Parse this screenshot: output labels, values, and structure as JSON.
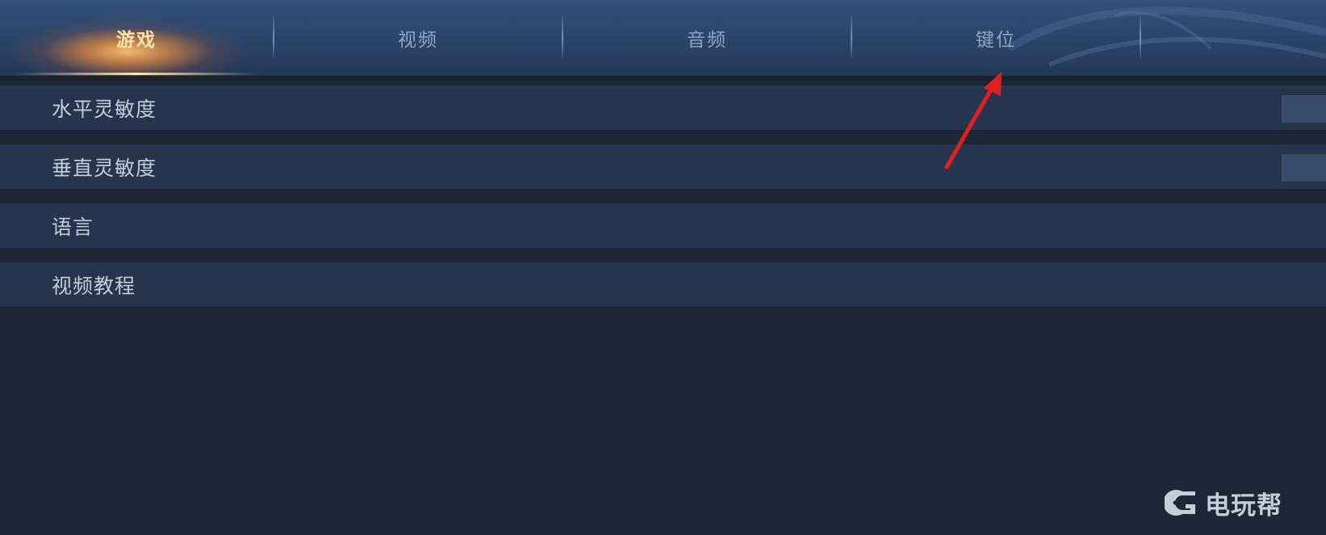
{
  "tabs": [
    {
      "label": "游戏",
      "active": true
    },
    {
      "label": "视频",
      "active": false
    },
    {
      "label": "音频",
      "active": false
    },
    {
      "label": "键位",
      "active": false
    }
  ],
  "settings": [
    {
      "label": "水平灵敏度"
    },
    {
      "label": "垂直灵敏度"
    },
    {
      "label": "语言"
    },
    {
      "label": "视频教程"
    }
  ],
  "annotation": {
    "arrow_color": "#e02020"
  },
  "watermark": {
    "text": "电玩帮",
    "icon": "gamepad-icon"
  },
  "colors": {
    "active_tab": "#ffe3a6",
    "inactive_tab": "#8fa3c2",
    "row_bg": "#27344d",
    "page_bg": "#1e2537"
  }
}
